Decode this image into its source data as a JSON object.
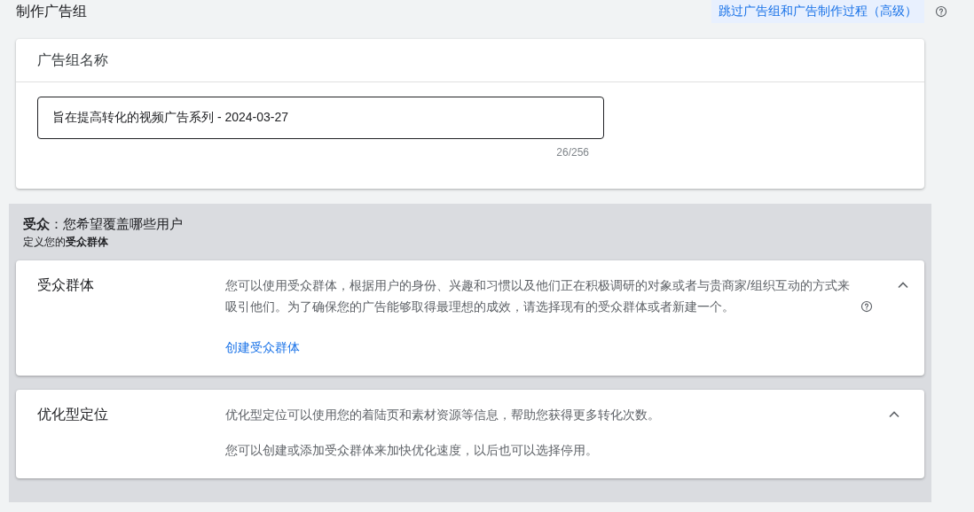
{
  "page_title": "制作广告组",
  "skip_link": "跳过广告组和广告制作过程（高级）",
  "ad_group_name": {
    "heading": "广告组名称",
    "value": "旨在提高转化的视频广告系列 - 2024-03-27",
    "counter": "26/256"
  },
  "audience": {
    "title": "**受众**：您希望覆盖哪些用户",
    "subtitle": "定义您的**受众群体**",
    "sections": [
      {
        "title": "受众群体",
        "expanded": true,
        "paragraphs": [
          "您可以使用受众群体，根据用户的身份、兴趣和习惯以及他们正在积极调研的对象或者与贵商家/组织互动的方式来吸引他们。为了确保您的广告能够取得最理想的成效，请选择现有的受众群体或者新建一个。"
        ],
        "help": true,
        "link": "创建受众群体"
      },
      {
        "title": "优化型定位",
        "expanded": true,
        "paragraphs": [
          "优化型定位可以使用您的着陆页和素材资源等信息，帮助您获得更多转化次数。",
          "您可以创建或添加受众群体来加快优化速度，以后也可以选择停用。"
        ],
        "help": false
      }
    ]
  }
}
